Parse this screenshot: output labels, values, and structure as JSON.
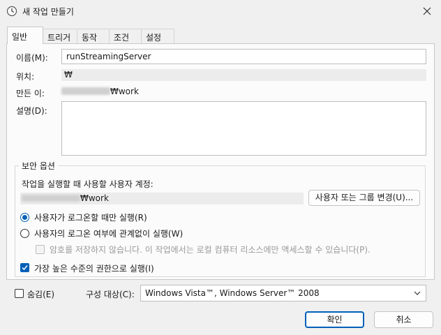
{
  "window": {
    "title": "새 작업 만들기",
    "icon": "clock-icon",
    "close": "close-icon"
  },
  "tabs": [
    {
      "label": "일반",
      "active": true
    },
    {
      "label": "트리거",
      "active": false
    },
    {
      "label": "동작",
      "active": false
    },
    {
      "label": "조건",
      "active": false
    },
    {
      "label": "설정",
      "active": false
    }
  ],
  "general": {
    "name_label": "이름(M):",
    "name_value": "runStreamingServer",
    "location_label": "위치:",
    "location_value": "₩",
    "author_label": "만든 이:",
    "author_value": "₩work",
    "description_label": "설명(D):",
    "description_value": ""
  },
  "security": {
    "group_title": "보안 옵션",
    "account_prompt": "작업을 실행할 때 사용할 사용자 계정:",
    "account_value": "₩work",
    "change_button": "사용자 또는 그룹 변경(U)...",
    "radio_logged_on": "사용자가 로그온할 때만 실행(R)",
    "radio_logged_on_checked": true,
    "radio_any": "사용자의 로그온 여부에 관계없이 실행(W)",
    "radio_any_checked": false,
    "no_store_password": "암호를 저장하지 않습니다. 이 작업에서는 로컬 컴퓨터 리소스에만 액세스할 수 있습니다(P).",
    "highest_privileges": "가장 높은 수준의 권한으로 실행(I)",
    "highest_privileges_checked": true
  },
  "footer": {
    "hidden_label": "숨김(E)",
    "configure_label": "구성 대상(C):",
    "configure_value": "Windows Vista™, Windows Server™ 2008",
    "ok_button": "확인",
    "cancel_button": "취소"
  },
  "colors": {
    "accent": "#005fb8",
    "background": "#f0f0f0",
    "panel": "#fbfbfb"
  }
}
